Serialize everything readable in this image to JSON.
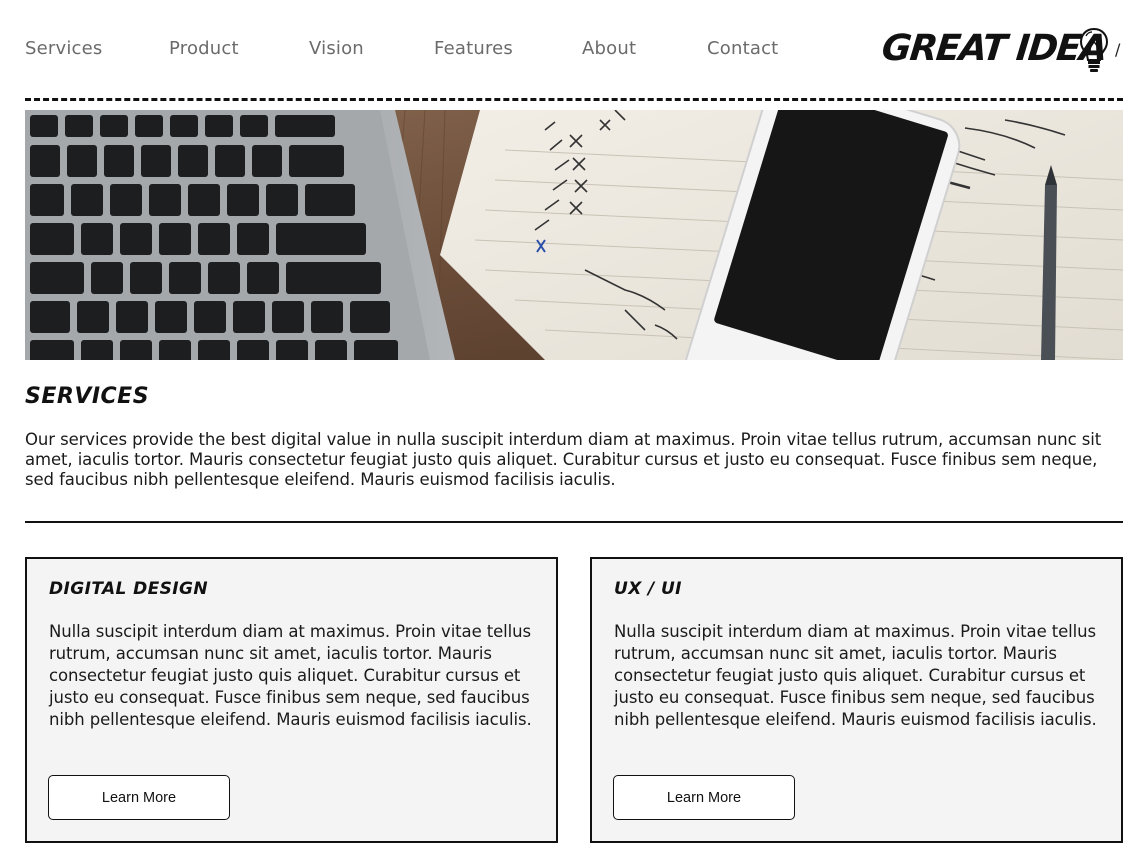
{
  "nav": {
    "items": [
      "Services",
      "Product",
      "Vision",
      "Features",
      "About",
      "Contact"
    ]
  },
  "logo": {
    "text": "GREAT IDEA",
    "icon": "lightbulb-icon",
    "suffix": "/"
  },
  "hero": {
    "image": "desk-laptop-phone-notebook-photo"
  },
  "services": {
    "title": "Services",
    "description": "Our services provide the best digital value in nulla suscipit interdum diam at maximus. Proin vitae tellus rutrum, accumsan nunc sit amet, iaculis tortor. Mauris consectetur feugiat justo quis aliquet. Curabitur cursus et justo eu consequat. Fusce finibus sem neque, sed faucibus nibh pellentesque eleifend. Mauris euismod facilisis iaculis."
  },
  "cards": [
    {
      "title": "Digital Design",
      "text": "Nulla suscipit interdum diam at maximus. Proin vitae tellus rutrum, accumsan nunc sit amet, iaculis tortor. Mauris consectetur feugiat justo quis aliquet. Curabitur cursus et justo eu consequat. Fusce finibus sem neque, sed faucibus nibh pellentesque eleifend. Mauris euismod facilisis iaculis.",
      "button": "Learn More"
    },
    {
      "title": "UX / UI",
      "text": "Nulla suscipit interdum diam at maximus. Proin vitae tellus rutrum, accumsan nunc sit amet, iaculis tortor. Mauris consectetur feugiat justo quis aliquet. Curabitur cursus et justo eu consequat. Fusce finibus sem neque, sed faucibus nibh pellentesque eleifend. Mauris euismod facilisis iaculis.",
      "button": "Learn More"
    }
  ],
  "colors": {
    "nav_text": "#6b6b6b",
    "text": "#1a1a1a",
    "card_bg": "#f4f4f4",
    "border": "#111111"
  }
}
